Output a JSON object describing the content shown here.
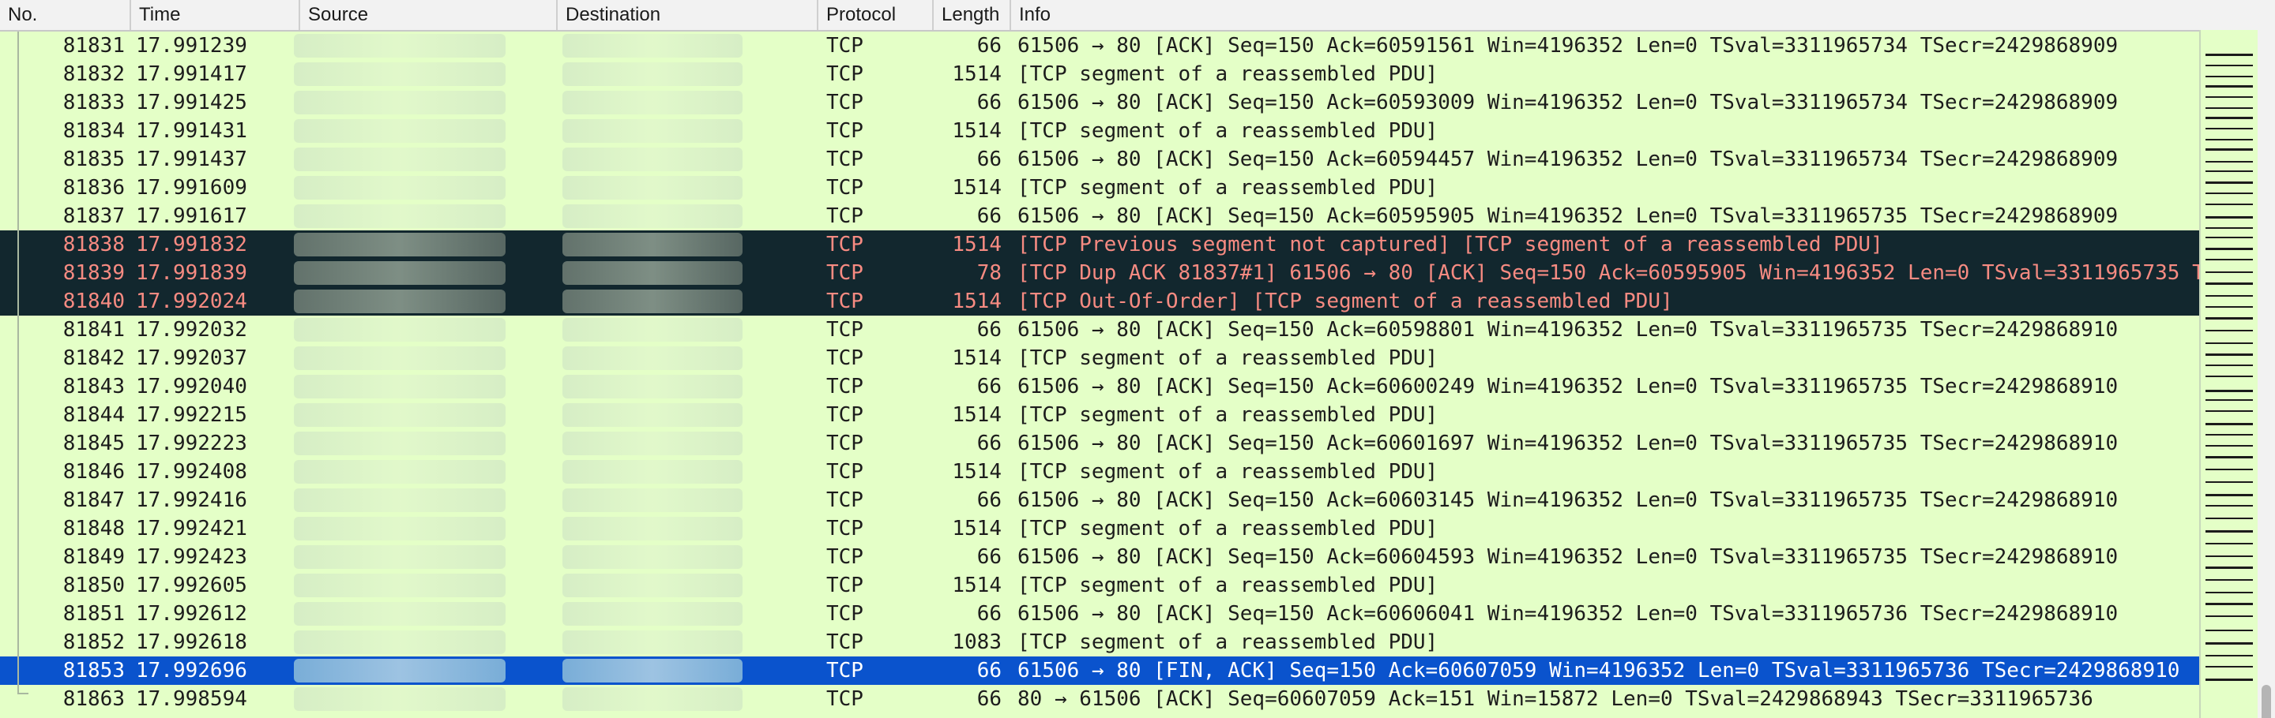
{
  "columns": {
    "no": "No.",
    "time": "Time",
    "source": "Source",
    "destination": "Destination",
    "protocol": "Protocol",
    "length": "Length",
    "info": "Info"
  },
  "packets": [
    {
      "no": "81831",
      "time": "17.991239",
      "protocol": "TCP",
      "length": "66",
      "info": "61506 → 80 [ACK] Seq=150 Ack=60591561 Win=4196352 Len=0 TSval=3311965734 TSecr=2429868909",
      "style": "normal"
    },
    {
      "no": "81832",
      "time": "17.991417",
      "protocol": "TCP",
      "length": "1514",
      "info": "[TCP segment of a reassembled PDU]",
      "style": "normal"
    },
    {
      "no": "81833",
      "time": "17.991425",
      "protocol": "TCP",
      "length": "66",
      "info": "61506 → 80 [ACK] Seq=150 Ack=60593009 Win=4196352 Len=0 TSval=3311965734 TSecr=2429868909",
      "style": "normal"
    },
    {
      "no": "81834",
      "time": "17.991431",
      "protocol": "TCP",
      "length": "1514",
      "info": "[TCP segment of a reassembled PDU]",
      "style": "normal"
    },
    {
      "no": "81835",
      "time": "17.991437",
      "protocol": "TCP",
      "length": "66",
      "info": "61506 → 80 [ACK] Seq=150 Ack=60594457 Win=4196352 Len=0 TSval=3311965734 TSecr=2429868909",
      "style": "normal"
    },
    {
      "no": "81836",
      "time": "17.991609",
      "protocol": "TCP",
      "length": "1514",
      "info": "[TCP segment of a reassembled PDU]",
      "style": "normal"
    },
    {
      "no": "81837",
      "time": "17.991617",
      "protocol": "TCP",
      "length": "66",
      "info": "61506 → 80 [ACK] Seq=150 Ack=60595905 Win=4196352 Len=0 TSval=3311965735 TSecr=2429868909",
      "style": "normal"
    },
    {
      "no": "81838",
      "time": "17.991832",
      "protocol": "TCP",
      "length": "1514",
      "info": "[TCP Previous segment not captured] [TCP segment of a reassembled PDU]",
      "style": "bad"
    },
    {
      "no": "81839",
      "time": "17.991839",
      "protocol": "TCP",
      "length": "78",
      "info": "[TCP Dup ACK 81837#1] 61506 → 80 [ACK] Seq=150 Ack=60595905 Win=4196352 Len=0 TSval=3311965735 T",
      "style": "bad"
    },
    {
      "no": "81840",
      "time": "17.992024",
      "protocol": "TCP",
      "length": "1514",
      "info": "[TCP Out-Of-Order] [TCP segment of a reassembled PDU]",
      "style": "bad"
    },
    {
      "no": "81841",
      "time": "17.992032",
      "protocol": "TCP",
      "length": "66",
      "info": "61506 → 80 [ACK] Seq=150 Ack=60598801 Win=4196352 Len=0 TSval=3311965735 TSecr=2429868910",
      "style": "normal"
    },
    {
      "no": "81842",
      "time": "17.992037",
      "protocol": "TCP",
      "length": "1514",
      "info": "[TCP segment of a reassembled PDU]",
      "style": "normal"
    },
    {
      "no": "81843",
      "time": "17.992040",
      "protocol": "TCP",
      "length": "66",
      "info": "61506 → 80 [ACK] Seq=150 Ack=60600249 Win=4196352 Len=0 TSval=3311965735 TSecr=2429868910",
      "style": "normal"
    },
    {
      "no": "81844",
      "time": "17.992215",
      "protocol": "TCP",
      "length": "1514",
      "info": "[TCP segment of a reassembled PDU]",
      "style": "normal"
    },
    {
      "no": "81845",
      "time": "17.992223",
      "protocol": "TCP",
      "length": "66",
      "info": "61506 → 80 [ACK] Seq=150 Ack=60601697 Win=4196352 Len=0 TSval=3311965735 TSecr=2429868910",
      "style": "normal"
    },
    {
      "no": "81846",
      "time": "17.992408",
      "protocol": "TCP",
      "length": "1514",
      "info": "[TCP segment of a reassembled PDU]",
      "style": "normal"
    },
    {
      "no": "81847",
      "time": "17.992416",
      "protocol": "TCP",
      "length": "66",
      "info": "61506 → 80 [ACK] Seq=150 Ack=60603145 Win=4196352 Len=0 TSval=3311965735 TSecr=2429868910",
      "style": "normal"
    },
    {
      "no": "81848",
      "time": "17.992421",
      "protocol": "TCP",
      "length": "1514",
      "info": "[TCP segment of a reassembled PDU]",
      "style": "normal"
    },
    {
      "no": "81849",
      "time": "17.992423",
      "protocol": "TCP",
      "length": "66",
      "info": "61506 → 80 [ACK] Seq=150 Ack=60604593 Win=4196352 Len=0 TSval=3311965735 TSecr=2429868910",
      "style": "normal"
    },
    {
      "no": "81850",
      "time": "17.992605",
      "protocol": "TCP",
      "length": "1514",
      "info": "[TCP segment of a reassembled PDU]",
      "style": "normal"
    },
    {
      "no": "81851",
      "time": "17.992612",
      "protocol": "TCP",
      "length": "66",
      "info": "61506 → 80 [ACK] Seq=150 Ack=60606041 Win=4196352 Len=0 TSval=3311965736 TSecr=2429868910",
      "style": "normal"
    },
    {
      "no": "81852",
      "time": "17.992618",
      "protocol": "TCP",
      "length": "1083",
      "info": "[TCP segment of a reassembled PDU]",
      "style": "normal"
    },
    {
      "no": "81853",
      "time": "17.992696",
      "protocol": "TCP",
      "length": "66",
      "info": "61506 → 80 [FIN, ACK] Seq=150 Ack=60607059 Win=4196352 Len=0 TSval=3311965736 TSecr=2429868910",
      "style": "selected"
    },
    {
      "no": "81863",
      "time": "17.998594",
      "protocol": "TCP",
      "length": "66",
      "info": "80 → 61506 [ACK] Seq=60607059 Ack=151 Win=15872 Len=0 TSval=2429868943 TSecr=3311965736",
      "style": "normal"
    }
  ],
  "colors": {
    "row_normal_bg": "#e4ffc7",
    "row_bad_bg": "#12272e",
    "row_bad_text": "#f78b82",
    "row_selected_bg": "#0a53cd",
    "row_selected_text": "#ffffff"
  }
}
